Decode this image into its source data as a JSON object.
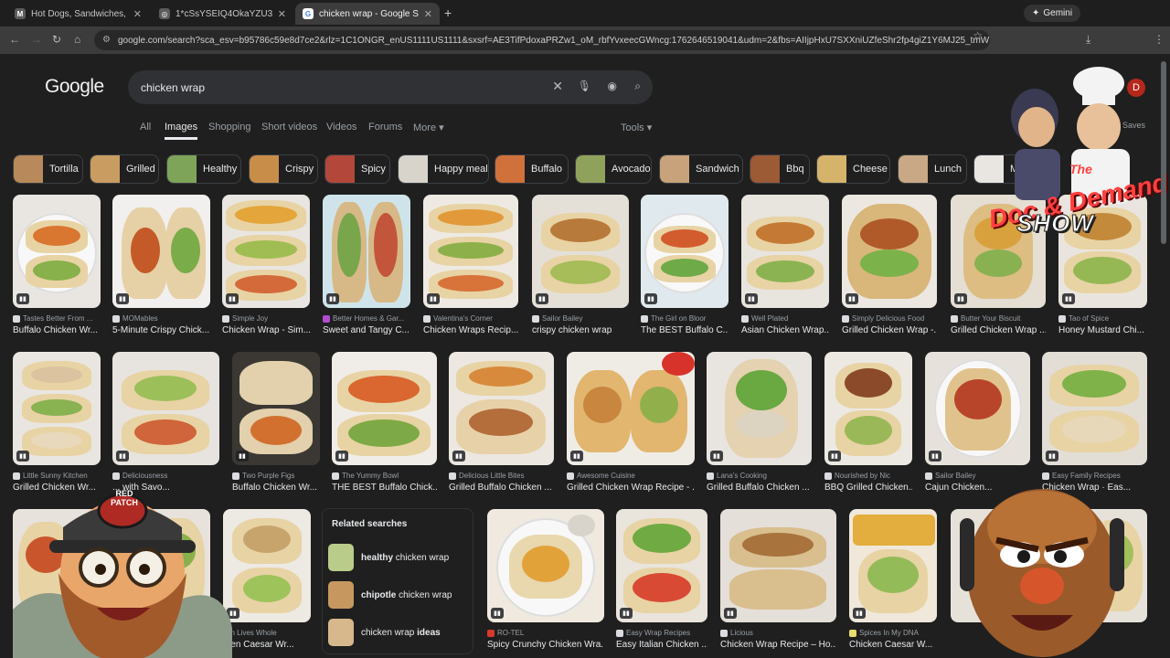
{
  "browser": {
    "tabs": [
      {
        "title": "Hot Dogs, Sandwiches, Metaph",
        "fav": "M",
        "fav_color": "#5b5b5b"
      },
      {
        "title": "1*cSsYSEIQ4OkaYZU3lDcVLQ.jp",
        "fav": "",
        "fav_color": "#5b5b5b"
      },
      {
        "title": "chicken wrap - Google Search",
        "fav": "G",
        "fav_color": "#4285f4"
      }
    ],
    "gemini_label": "Gemini",
    "url": "google.com/search?sca_esv=b95786c59e8d7ce2&rlz=1C1ONGR_enUS1111US1111&sxsrf=AE3TifPdoxaPRZw1_oM_rbfYvxeecGWncg:1762646519041&udm=2&fbs=AIIjpHxU7SXXniUZfeShr2fp4giZ1Y6MJ25_tmWITc7uy4Klei..."
  },
  "google": {
    "logo": "Google",
    "query": "chicken wrap",
    "menu": [
      "All",
      "Images",
      "Shopping",
      "Short videos",
      "Videos",
      "Forums",
      "More"
    ],
    "tools": "Tools",
    "avatar": "D",
    "saves": "Saves"
  },
  "chips": [
    {
      "label": "Tortilla"
    },
    {
      "label": "Grilled"
    },
    {
      "label": "Healthy"
    },
    {
      "label": "Crispy"
    },
    {
      "label": "Spicy"
    },
    {
      "label": "Happy meal"
    },
    {
      "label": "Buffalo"
    },
    {
      "label": "Avocado"
    },
    {
      "label": "Sandwich"
    },
    {
      "label": "Bbq"
    },
    {
      "label": "Cheese"
    },
    {
      "label": "Lunch"
    },
    {
      "label": "Mi"
    }
  ],
  "row1": [
    {
      "source": "Tastes Better From ...",
      "caption": "Buffalo Chicken Wr..."
    },
    {
      "source": "MOMables",
      "caption": "5-Minute Crispy Chick..."
    },
    {
      "source": "Simple Joy",
      "caption": "Chicken Wrap - Sim..."
    },
    {
      "source": "Better Homes & Gar...",
      "caption": "Sweet and Tangy C..."
    },
    {
      "source": "Valentina's Corner",
      "caption": "Chicken Wraps Recip..."
    },
    {
      "source": "Sailor Bailey",
      "caption": "crispy chicken wrap"
    },
    {
      "source": "The Girl on Bloor",
      "caption": "The BEST Buffalo C..."
    },
    {
      "source": "Well Plated",
      "caption": "Asian Chicken Wrap..."
    },
    {
      "source": "Simply Delicious Food",
      "caption": "Grilled Chicken Wrap -..."
    },
    {
      "source": "Butter Your Biscuit",
      "caption": "Grilled Chicken Wrap ..."
    },
    {
      "source": "Tao of Spice",
      "caption": "Honey Mustard Chi..."
    }
  ],
  "row2": [
    {
      "source": "Little Sunny Kitchen",
      "caption": "Grilled Chicken Wr..."
    },
    {
      "source": "Deliciousness",
      "caption": "... with Savo..."
    },
    {
      "source": "Two Purple Figs",
      "caption": "Buffalo Chicken Wr..."
    },
    {
      "source": "The Yummy Bowl",
      "caption": "THE BEST Buffalo Chick..."
    },
    {
      "source": "Delicious Little Bites",
      "caption": "Grilled Buffalo Chicken ..."
    },
    {
      "source": "Awesome Cuisine",
      "caption": "Grilled Chicken Wrap Recipe - ..."
    },
    {
      "source": "Lana's Cooking",
      "caption": "Grilled Buffalo Chicken ..."
    },
    {
      "source": "Nourished by Nic",
      "caption": "BBQ Grilled Chicken..."
    },
    {
      "source": "Sailor Bailey",
      "caption": "Cajun Chicken..."
    },
    {
      "source": "Easy Family Recipes",
      "caption": "Chicken Wrap · Eas..."
    }
  ],
  "row3": [
    {
      "source": "",
      "caption": ""
    },
    {
      "source": "...in Lives Whole",
      "caption": "...en Caesar Wr..."
    },
    {
      "source": "RO-TEL",
      "caption": "Spicy Crunchy Chicken Wra..."
    },
    {
      "source": "Easy Wrap Recipes",
      "caption": "Easy Italian Chicken ..."
    },
    {
      "source": "Licious",
      "caption": "Chicken Wrap Recipe – Ho..."
    },
    {
      "source": "Spices In My DNA",
      "caption": "Chicken Caesar W..."
    }
  ],
  "related": {
    "title": "Related searches",
    "items": [
      {
        "bold": "healthy",
        "rest": " chicken wrap"
      },
      {
        "bold": "chipotle",
        "rest": " chicken wrap"
      },
      {
        "bold": "",
        "rest": "chicken wrap ",
        "bold2": "ideas"
      }
    ]
  },
  "overlay": {
    "the": "The",
    "title": "Doc & Demand",
    "subtitle": "SHOW",
    "hat_text": "RED PATCH"
  }
}
